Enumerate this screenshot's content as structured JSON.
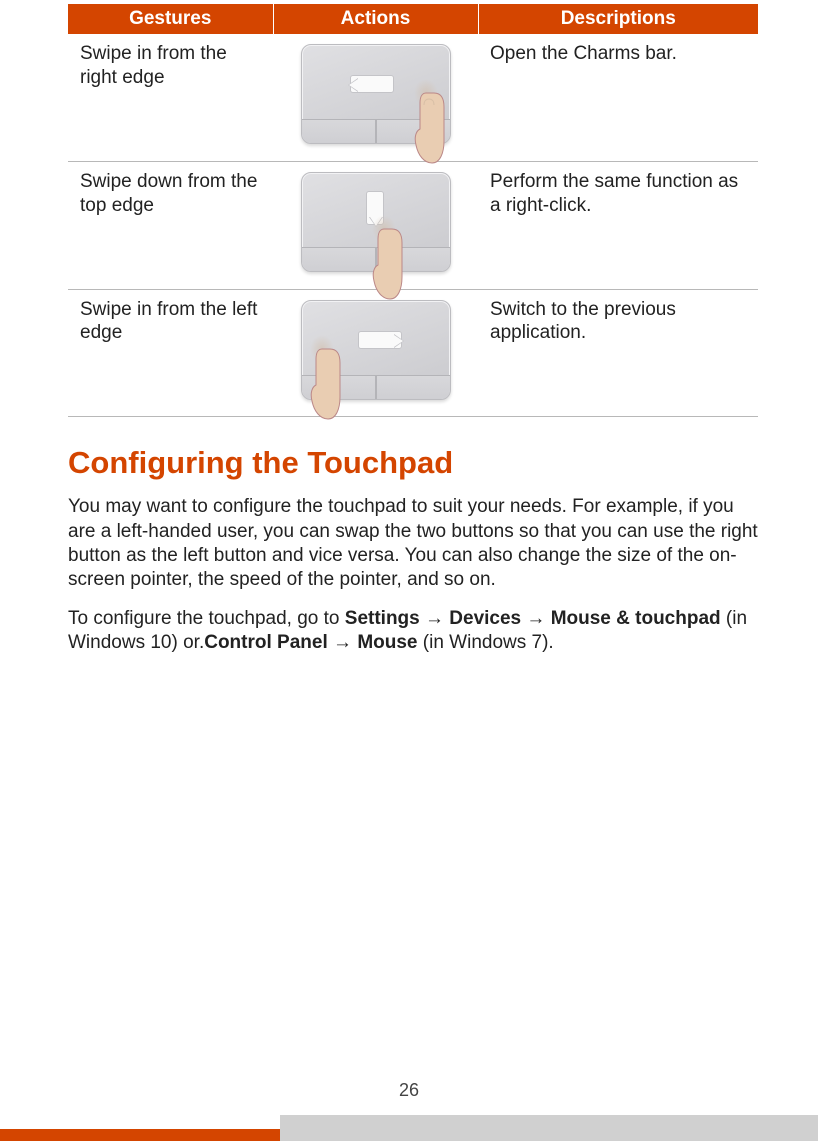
{
  "table": {
    "headers": [
      "Gestures",
      "Actions",
      "Descriptions"
    ],
    "rows": [
      {
        "gesture": "Swipe in from the right edge",
        "description": "Open the Charms bar."
      },
      {
        "gesture": "Swipe down from the top edge",
        "description": "Perform the same function as a right-click."
      },
      {
        "gesture": "Swipe in from the left edge",
        "description": "Switch to the previous application."
      }
    ]
  },
  "section_heading": "Configuring the Touchpad",
  "paragraph1": "You may want to configure the touchpad to suit your needs. For example, if you are a left-handed user, you can swap the two buttons so that you can use the right button as the left button and vice versa. You can also change the size of the on-screen pointer, the speed of the pointer, and so on.",
  "paragraph2": {
    "pre": "To configure the touchpad, go to ",
    "path1_a": "Settings",
    "arrow": " → ",
    "path1_b": "Devices",
    "path1_c": "Mouse & touchpad",
    "mid1": " (in Windows 10) or.",
    "path2_a": "Control Panel",
    "path2_b": "Mouse",
    "mid2": " (in Windows 7)."
  },
  "page_number": "26"
}
